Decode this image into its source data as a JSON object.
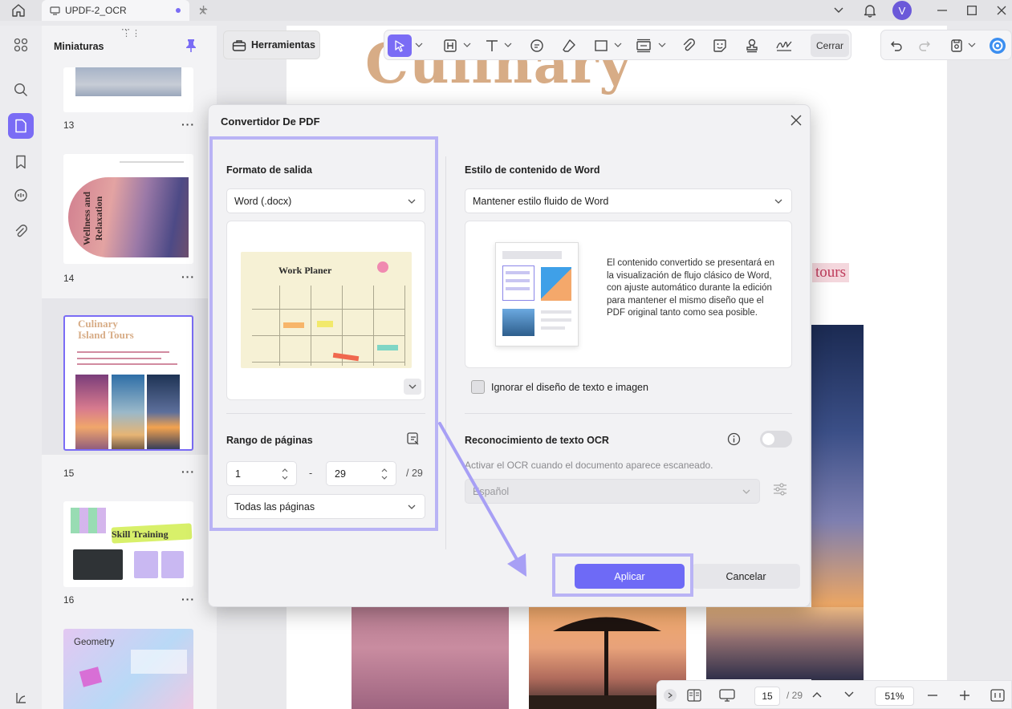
{
  "tab": {
    "title": "UPDF-2_OCR"
  },
  "user": {
    "initial": "V"
  },
  "thumbnails": {
    "title": "Miniaturas",
    "pages": [
      {
        "number": "13"
      },
      {
        "number": "14",
        "text": "Wellness and Relaxation"
      },
      {
        "number": "15",
        "title_1": "Culinary",
        "title_2": "Island Tours"
      },
      {
        "number": "16",
        "title": "Skill Training"
      },
      {
        "title": "Geometry"
      }
    ],
    "more": "···"
  },
  "toolbar": {
    "tools_label": "Herramientas",
    "close_label": "Cerrar"
  },
  "document": {
    "title": "Culinary",
    "tours": "tours"
  },
  "dialog": {
    "title": "Convertidor De PDF",
    "output_format_title": "Formato de salida",
    "output_format_value": "Word (.docx)",
    "preview_title": "Work Planer",
    "page_range_title": "Rango de páginas",
    "range_from": "1",
    "range_dash": "-",
    "range_to": "29",
    "range_total": "/ 29",
    "pages_option": "Todas las páginas",
    "word_style_title": "Estilo de contenido de Word",
    "word_style_value": "Mantener estilo fluido de Word",
    "word_style_description": "El contenido convertido se presentará en la visualización de flujo clásico de Word, con ajuste automático durante la edición para mantener el mismo diseño que el PDF original tanto como sea posible.",
    "ignore_layout_label": "Ignorar el diseño de texto e imagen",
    "ocr_title": "Reconocimiento de texto OCR",
    "ocr_hint": "Activar el OCR cuando el documento aparece escaneado.",
    "ocr_language": "Español",
    "apply_label": "Aplicar",
    "cancel_label": "Cancelar"
  },
  "bottom_bar": {
    "current_page": "15",
    "total_pages": "/ 29",
    "zoom": "51%"
  },
  "colors": {
    "accent": "#6e6af6",
    "highlight": "#b9b3f5"
  }
}
